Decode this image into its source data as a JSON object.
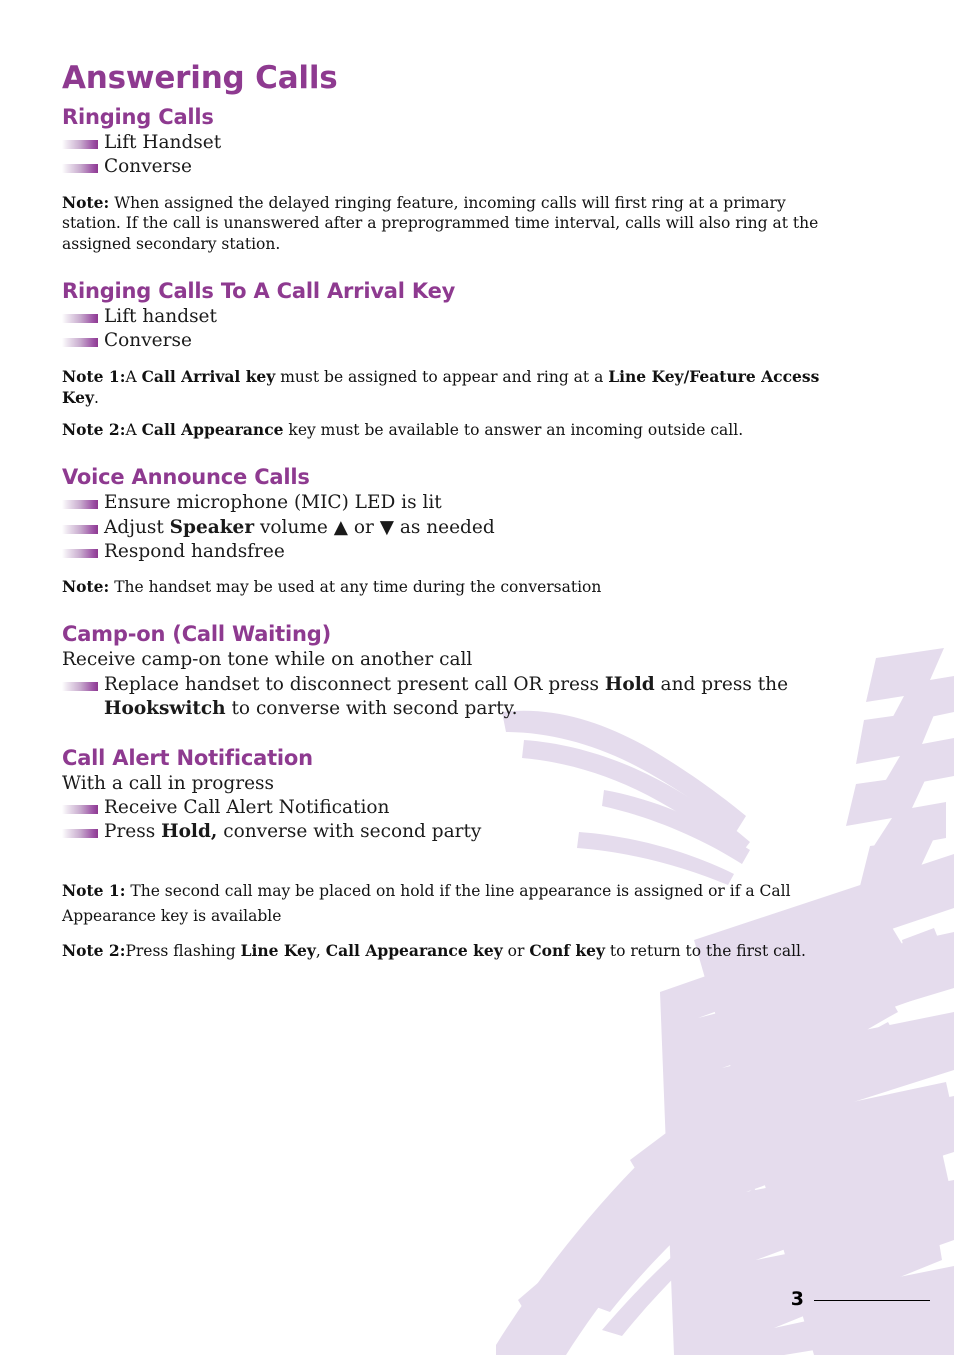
{
  "document": {
    "title": "Answering Calls",
    "page_number": "3"
  },
  "colors": {
    "heading_purple": "#8e3a90",
    "bullet_purple": "#8e3a90",
    "brush_lavender": "#e5dced",
    "body_text": "#1a1a1a"
  },
  "sections": [
    {
      "title": "Ringing Calls",
      "steps": [
        {
          "type": "bullet",
          "text": "Lift Handset"
        },
        {
          "type": "bullet",
          "text": "Converse"
        }
      ],
      "notes": [
        {
          "label": "Note:",
          "text": "When assigned the delayed ringing feature, incoming calls will first ring at a primary station.  If the call is unanswered after a preprogrammed time interval, calls will also ring at the assigned secondary station."
        }
      ]
    },
    {
      "title": "Ringing Calls To A Call Arrival Key",
      "steps": [
        {
          "type": "bullet",
          "text": "Lift handset"
        },
        {
          "type": "bullet",
          "text": "Converse"
        }
      ],
      "notes": [
        {
          "label": "Note 1:",
          "text": "A Call Arrival key must be assigned to appear and ring at a Line Key/Feature Access Key.",
          "bold_spans": [
            "Call Arrival key",
            "Line Key/Feature Access Key"
          ]
        },
        {
          "label": "Note 2:",
          "text": "A Call Appearance key must be available to answer an incoming outside call.",
          "bold_spans": [
            "Call Appearance"
          ]
        }
      ]
    },
    {
      "title": "Voice Announce Calls",
      "steps": [
        {
          "type": "bullet",
          "text": "Ensure microphone (MIC) LED is lit"
        },
        {
          "type": "bullet",
          "text": "Adjust Speaker volume ▲ or ▼ as needed",
          "bold_spans": [
            "Speaker"
          ]
        },
        {
          "type": "bullet",
          "text": "Respond handsfree"
        }
      ],
      "notes": [
        {
          "label": "Note:",
          "text": "The handset may be used at any time during the conversation"
        }
      ]
    },
    {
      "title": "Camp-on (Call Waiting)",
      "steps": [
        {
          "type": "plain",
          "text": "Receive camp-on tone while on another call"
        },
        {
          "type": "bullet",
          "text": "Replace handset to disconnect present call OR press Hold and press the Hookswitch to converse with second party.",
          "bold_spans": [
            "Hold",
            "Hookswitch"
          ]
        }
      ],
      "notes": []
    },
    {
      "title": "Call Alert Notification",
      "steps": [
        {
          "type": "plain",
          "text": "With a call in progress"
        },
        {
          "type": "bullet",
          "text": "Receive Call Alert Notification"
        },
        {
          "type": "bullet",
          "text": "Press Hold, converse with second party",
          "bold_spans": [
            "Hold,"
          ]
        }
      ],
      "notes": [
        {
          "label": "Note 1:",
          "text": "The second call may be placed on hold if the line appearance is assigned or if a Call Appearance key is available"
        },
        {
          "label": "Note 2:",
          "text": "Press flashing Line Key, Call Appearance key or Conf key to return to the first call.",
          "bold_spans": [
            "Line Key",
            "Call Appearance key",
            "Conf key"
          ]
        }
      ]
    }
  ],
  "text": {
    "s1_step1": "Lift Handset",
    "s1_step2": "Converse",
    "s1_note_label": "Note:",
    "s1_note_body": "When assigned the delayed ringing feature, incoming calls will first ring at a primary station.  If the call is unanswered after a preprogrammed time interval, calls will also ring at the assigned secondary station.",
    "s2_step1": "Lift handset",
    "s2_step2": "Converse",
    "s2_note1_label": "Note 1:",
    "s2_note1_a": "A ",
    "s2_note1_b1": "Call Arrival key",
    "s2_note1_c": " must be assigned to appear and ring at a ",
    "s2_note1_b2": "Line Key/Feature Access Key",
    "s2_note1_d": ".",
    "s2_note2_label": "Note 2:",
    "s2_note2_a": "A ",
    "s2_note2_b1": "Call Appearance",
    "s2_note2_c": " key must be available to answer an incoming outside call.",
    "s3_step1": "Ensure microphone (MIC) LED is lit",
    "s3_step2_a": "Adjust ",
    "s3_step2_b": "Speaker",
    "s3_step2_c": " volume ▲ or ▼ as needed",
    "s3_step3": "Respond handsfree",
    "s3_note_label": "Note:",
    "s3_note_body": "The handset may be used at any time during the conversation",
    "s4_plain": "Receive camp-on tone while on another call",
    "s4_step_a": "Replace handset to disconnect present call OR press ",
    "s4_step_b1": "Hold",
    "s4_step_c": " and press the ",
    "s4_step_b2": "Hookswitch",
    "s4_step_d": " to converse with second party.",
    "s5_plain": "With a call in progress",
    "s5_step1": "Receive Call Alert Notification",
    "s5_step2_a": "Press ",
    "s5_step2_b": "Hold,",
    "s5_step2_c": " converse with second party",
    "s5_note1_label": "Note 1:",
    "s5_note1_body": "The second call may be placed on hold if the line appearance is assigned or if a Call Appearance key is available",
    "s5_note2_label": "Note 2:",
    "s5_note2_a": "Press flashing ",
    "s5_note2_b1": "Line Key",
    "s5_note2_c": ", ",
    "s5_note2_b2": "Call Appearance key",
    "s5_note2_e": " or ",
    "s5_note2_b3": "Conf key",
    "s5_note2_f": " to return to the first call."
  }
}
